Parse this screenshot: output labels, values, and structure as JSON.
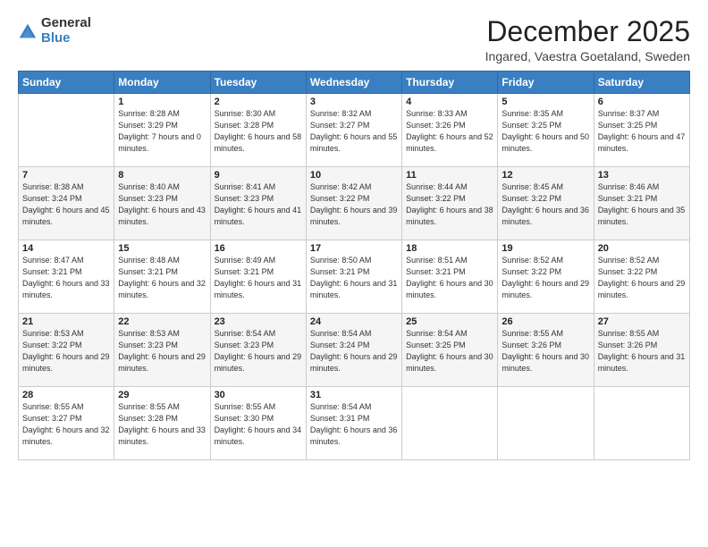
{
  "logo": {
    "general": "General",
    "blue": "Blue"
  },
  "title": "December 2025",
  "subtitle": "Ingared, Vaestra Goetaland, Sweden",
  "days_header": [
    "Sunday",
    "Monday",
    "Tuesday",
    "Wednesday",
    "Thursday",
    "Friday",
    "Saturday"
  ],
  "weeks": [
    [
      {
        "day": "",
        "sunrise": "",
        "sunset": "",
        "daylight": ""
      },
      {
        "day": "1",
        "sunrise": "Sunrise: 8:28 AM",
        "sunset": "Sunset: 3:29 PM",
        "daylight": "Daylight: 7 hours and 0 minutes."
      },
      {
        "day": "2",
        "sunrise": "Sunrise: 8:30 AM",
        "sunset": "Sunset: 3:28 PM",
        "daylight": "Daylight: 6 hours and 58 minutes."
      },
      {
        "day": "3",
        "sunrise": "Sunrise: 8:32 AM",
        "sunset": "Sunset: 3:27 PM",
        "daylight": "Daylight: 6 hours and 55 minutes."
      },
      {
        "day": "4",
        "sunrise": "Sunrise: 8:33 AM",
        "sunset": "Sunset: 3:26 PM",
        "daylight": "Daylight: 6 hours and 52 minutes."
      },
      {
        "day": "5",
        "sunrise": "Sunrise: 8:35 AM",
        "sunset": "Sunset: 3:25 PM",
        "daylight": "Daylight: 6 hours and 50 minutes."
      },
      {
        "day": "6",
        "sunrise": "Sunrise: 8:37 AM",
        "sunset": "Sunset: 3:25 PM",
        "daylight": "Daylight: 6 hours and 47 minutes."
      }
    ],
    [
      {
        "day": "7",
        "sunrise": "Sunrise: 8:38 AM",
        "sunset": "Sunset: 3:24 PM",
        "daylight": "Daylight: 6 hours and 45 minutes."
      },
      {
        "day": "8",
        "sunrise": "Sunrise: 8:40 AM",
        "sunset": "Sunset: 3:23 PM",
        "daylight": "Daylight: 6 hours and 43 minutes."
      },
      {
        "day": "9",
        "sunrise": "Sunrise: 8:41 AM",
        "sunset": "Sunset: 3:23 PM",
        "daylight": "Daylight: 6 hours and 41 minutes."
      },
      {
        "day": "10",
        "sunrise": "Sunrise: 8:42 AM",
        "sunset": "Sunset: 3:22 PM",
        "daylight": "Daylight: 6 hours and 39 minutes."
      },
      {
        "day": "11",
        "sunrise": "Sunrise: 8:44 AM",
        "sunset": "Sunset: 3:22 PM",
        "daylight": "Daylight: 6 hours and 38 minutes."
      },
      {
        "day": "12",
        "sunrise": "Sunrise: 8:45 AM",
        "sunset": "Sunset: 3:22 PM",
        "daylight": "Daylight: 6 hours and 36 minutes."
      },
      {
        "day": "13",
        "sunrise": "Sunrise: 8:46 AM",
        "sunset": "Sunset: 3:21 PM",
        "daylight": "Daylight: 6 hours and 35 minutes."
      }
    ],
    [
      {
        "day": "14",
        "sunrise": "Sunrise: 8:47 AM",
        "sunset": "Sunset: 3:21 PM",
        "daylight": "Daylight: 6 hours and 33 minutes."
      },
      {
        "day": "15",
        "sunrise": "Sunrise: 8:48 AM",
        "sunset": "Sunset: 3:21 PM",
        "daylight": "Daylight: 6 hours and 32 minutes."
      },
      {
        "day": "16",
        "sunrise": "Sunrise: 8:49 AM",
        "sunset": "Sunset: 3:21 PM",
        "daylight": "Daylight: 6 hours and 31 minutes."
      },
      {
        "day": "17",
        "sunrise": "Sunrise: 8:50 AM",
        "sunset": "Sunset: 3:21 PM",
        "daylight": "Daylight: 6 hours and 31 minutes."
      },
      {
        "day": "18",
        "sunrise": "Sunrise: 8:51 AM",
        "sunset": "Sunset: 3:21 PM",
        "daylight": "Daylight: 6 hours and 30 minutes."
      },
      {
        "day": "19",
        "sunrise": "Sunrise: 8:52 AM",
        "sunset": "Sunset: 3:22 PM",
        "daylight": "Daylight: 6 hours and 29 minutes."
      },
      {
        "day": "20",
        "sunrise": "Sunrise: 8:52 AM",
        "sunset": "Sunset: 3:22 PM",
        "daylight": "Daylight: 6 hours and 29 minutes."
      }
    ],
    [
      {
        "day": "21",
        "sunrise": "Sunrise: 8:53 AM",
        "sunset": "Sunset: 3:22 PM",
        "daylight": "Daylight: 6 hours and 29 minutes."
      },
      {
        "day": "22",
        "sunrise": "Sunrise: 8:53 AM",
        "sunset": "Sunset: 3:23 PM",
        "daylight": "Daylight: 6 hours and 29 minutes."
      },
      {
        "day": "23",
        "sunrise": "Sunrise: 8:54 AM",
        "sunset": "Sunset: 3:23 PM",
        "daylight": "Daylight: 6 hours and 29 minutes."
      },
      {
        "day": "24",
        "sunrise": "Sunrise: 8:54 AM",
        "sunset": "Sunset: 3:24 PM",
        "daylight": "Daylight: 6 hours and 29 minutes."
      },
      {
        "day": "25",
        "sunrise": "Sunrise: 8:54 AM",
        "sunset": "Sunset: 3:25 PM",
        "daylight": "Daylight: 6 hours and 30 minutes."
      },
      {
        "day": "26",
        "sunrise": "Sunrise: 8:55 AM",
        "sunset": "Sunset: 3:26 PM",
        "daylight": "Daylight: 6 hours and 30 minutes."
      },
      {
        "day": "27",
        "sunrise": "Sunrise: 8:55 AM",
        "sunset": "Sunset: 3:26 PM",
        "daylight": "Daylight: 6 hours and 31 minutes."
      }
    ],
    [
      {
        "day": "28",
        "sunrise": "Sunrise: 8:55 AM",
        "sunset": "Sunset: 3:27 PM",
        "daylight": "Daylight: 6 hours and 32 minutes."
      },
      {
        "day": "29",
        "sunrise": "Sunrise: 8:55 AM",
        "sunset": "Sunset: 3:28 PM",
        "daylight": "Daylight: 6 hours and 33 minutes."
      },
      {
        "day": "30",
        "sunrise": "Sunrise: 8:55 AM",
        "sunset": "Sunset: 3:30 PM",
        "daylight": "Daylight: 6 hours and 34 minutes."
      },
      {
        "day": "31",
        "sunrise": "Sunrise: 8:54 AM",
        "sunset": "Sunset: 3:31 PM",
        "daylight": "Daylight: 6 hours and 36 minutes."
      },
      {
        "day": "",
        "sunrise": "",
        "sunset": "",
        "daylight": ""
      },
      {
        "day": "",
        "sunrise": "",
        "sunset": "",
        "daylight": ""
      },
      {
        "day": "",
        "sunrise": "",
        "sunset": "",
        "daylight": ""
      }
    ]
  ]
}
